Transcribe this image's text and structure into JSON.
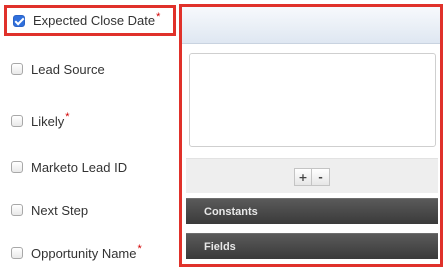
{
  "fields": [
    {
      "label": "Expected Close Date",
      "required": true,
      "checked": true
    },
    {
      "label": "Lead Source",
      "required": false,
      "checked": false
    },
    {
      "label": "Likely",
      "required": true,
      "checked": false
    },
    {
      "label": "Marketo Lead ID",
      "required": false,
      "checked": false
    },
    {
      "label": "Next Step",
      "required": false,
      "checked": false
    },
    {
      "label": "Opportunity Name",
      "required": true,
      "checked": false
    }
  ],
  "required_marker": "*",
  "builder": {
    "add_label": "+",
    "remove_label": "-",
    "constants_label": "Constants",
    "fields_label": "Fields"
  },
  "colors": {
    "highlight": "#e0312a",
    "required": "#d20000",
    "checkbox_checked": "#2f6fdc"
  }
}
